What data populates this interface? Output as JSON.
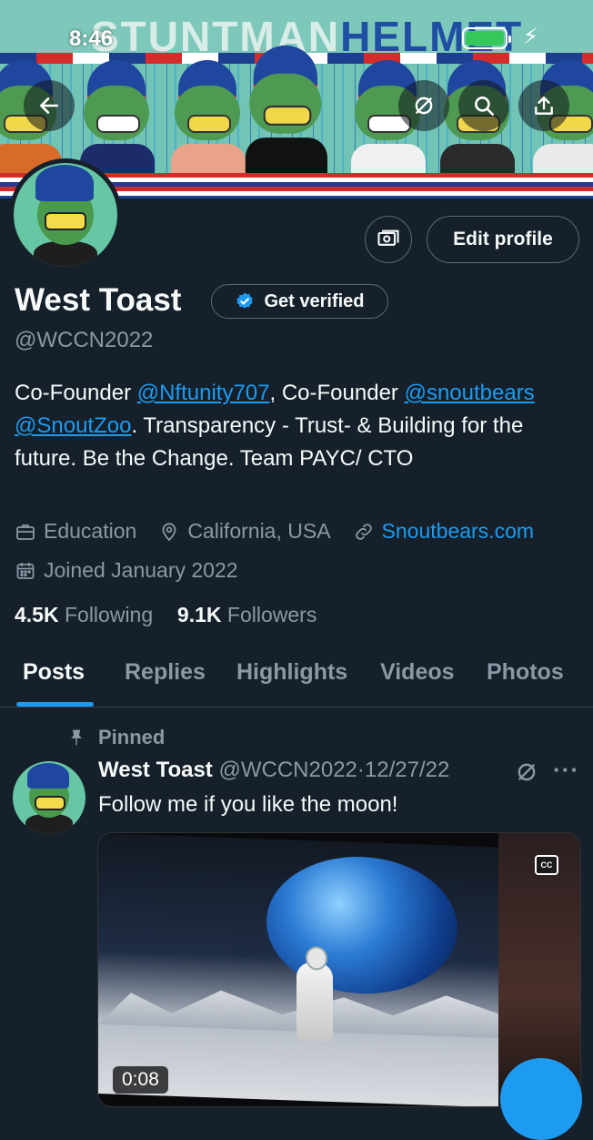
{
  "status_bar": {
    "time": "8:46",
    "battery_color": "#34c759"
  },
  "banner": {
    "title_part1": "STUNTMAN",
    "title_part2": "HELMET"
  },
  "header_icons": [
    "back-arrow-icon",
    "grok-icon",
    "search-icon",
    "share-icon"
  ],
  "profile": {
    "name": "West Toast",
    "get_verified_label": "Get verified",
    "handle": "@WCCN2022",
    "edit_profile_label": "Edit profile",
    "bio": {
      "p1": "Co-Founder ",
      "link1": "@Nftunity707",
      "p2": ", Co-Founder ",
      "link2": "@snoutbears",
      "p3": " ",
      "link3": "@SnoutZoo",
      "p4": ". Transparency - Trust- & Building for the future. Be the Change. Team PAYC/ CTO"
    },
    "category": "Education",
    "location": "California, USA",
    "website": "Snoutbears.com",
    "joined": "Joined January 2022",
    "following_count": "4.5K",
    "following_label": "Following",
    "followers_count": "9.1K",
    "followers_label": "Followers"
  },
  "tabs": [
    {
      "label": "Posts",
      "active": true
    },
    {
      "label": "Replies",
      "active": false
    },
    {
      "label": "Highlights",
      "active": false
    },
    {
      "label": "Videos",
      "active": false
    },
    {
      "label": "Photos",
      "active": false
    }
  ],
  "pinned_post": {
    "pinned_label": "Pinned",
    "author_name": "West Toast",
    "author_handle": "@WCCN2022",
    "separator": "·",
    "date": "12/27/22",
    "text": "Follow me if you like the moon!",
    "more_glyph": "···",
    "media": {
      "cc_label": "CC",
      "duration": "0:08"
    }
  },
  "colors": {
    "background": "#15202b",
    "accent": "#1d9bf0",
    "muted": "#8b98a5",
    "text": "#f7f9f9"
  }
}
